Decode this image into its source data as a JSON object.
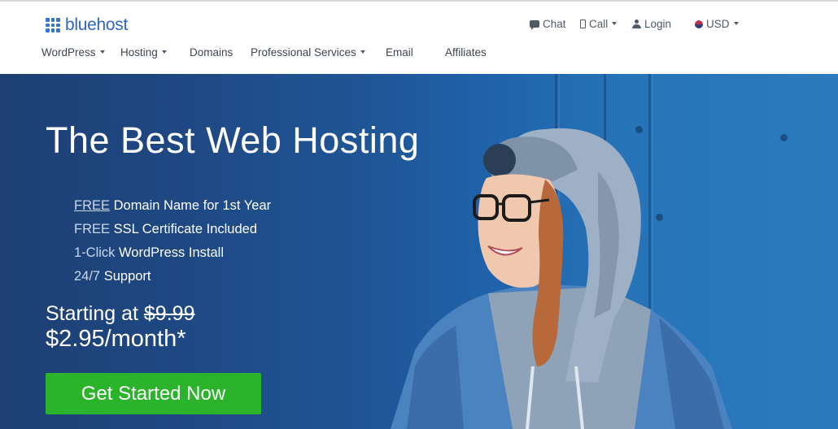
{
  "brand": {
    "name": "bluehost",
    "color": "#3575d3"
  },
  "utility": {
    "chat": {
      "label": "Chat",
      "icon": "chat-icon"
    },
    "call": {
      "label": "Call",
      "icon": "phone-icon"
    },
    "login": {
      "label": "Login",
      "icon": "user-icon"
    },
    "currency": {
      "label": "USD",
      "icon": "us-flag-icon"
    }
  },
  "nav": [
    {
      "label": "WordPress",
      "has_dropdown": true
    },
    {
      "label": "Hosting",
      "has_dropdown": true
    },
    {
      "label": "Domains",
      "has_dropdown": false
    },
    {
      "label": "Professional Services",
      "has_dropdown": true
    },
    {
      "label": "Email",
      "has_dropdown": false
    },
    {
      "label": "Affiliates",
      "has_dropdown": false
    }
  ],
  "hero": {
    "headline": "The Best Web Hosting",
    "features": [
      {
        "prefix": "FREE",
        "text": " Domain Name for 1st Year"
      },
      {
        "prefix": "FREE",
        "text": " SSL Certificate Included"
      },
      {
        "prefix": "1-Click",
        "text": " WordPress Install"
      },
      {
        "prefix": "24/7",
        "text": " Support"
      }
    ],
    "starting_label": "Starting at ",
    "old_price": "$9.99",
    "price": "$2.95/month*",
    "cta_label": "Get Started Now",
    "cta_color": "#2cb32c",
    "background_color": "#1f5697"
  }
}
